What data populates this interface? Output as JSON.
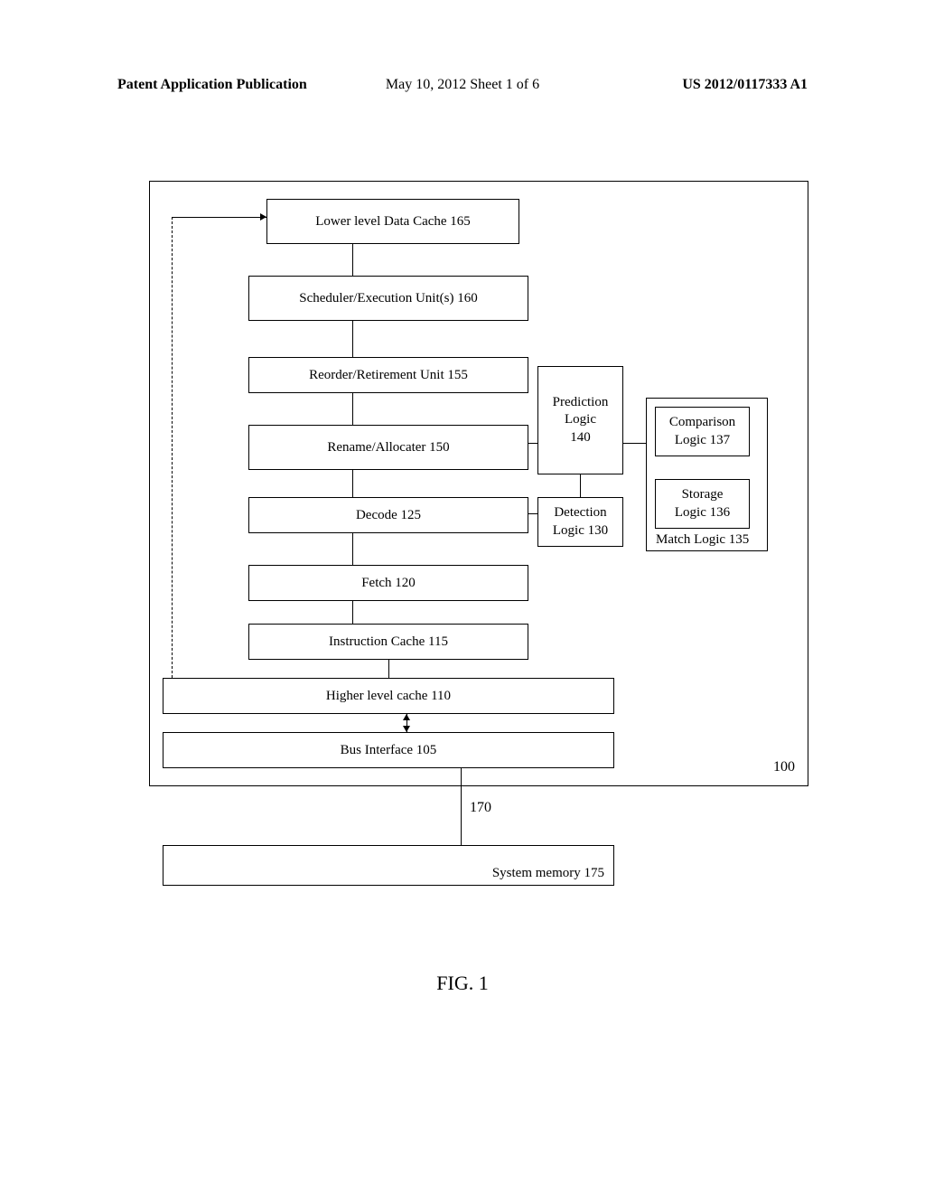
{
  "header": {
    "left": "Patent Application Publication",
    "center": "May 10, 2012  Sheet 1 of 6",
    "right": "US 2012/0117333 A1"
  },
  "blocks": {
    "b165": "Lower level Data Cache 165",
    "b160": "Scheduler/Execution Unit(s) 160",
    "b155": "Reorder/Retirement Unit 155",
    "b150": "Rename/Allocater 150",
    "b125": "Decode 125",
    "b120": "Fetch 120",
    "b115": "Instruction Cache 115",
    "b110": "Higher level cache 110",
    "b105": "Bus Interface 105",
    "b140_line1": "Prediction",
    "b140_line2": "Logic",
    "b140_line3": "140",
    "b130_line1": "Detection",
    "b130_line2": "Logic 130",
    "b137_line1": "Comparison",
    "b137_line2": "Logic 137",
    "b136_line1": "Storage",
    "b136_line2": "Logic 136",
    "b135": "Match Logic 135",
    "b175": "System memory 175"
  },
  "labels": {
    "l100": "100",
    "l170": "170"
  },
  "figure": "FIG. 1"
}
